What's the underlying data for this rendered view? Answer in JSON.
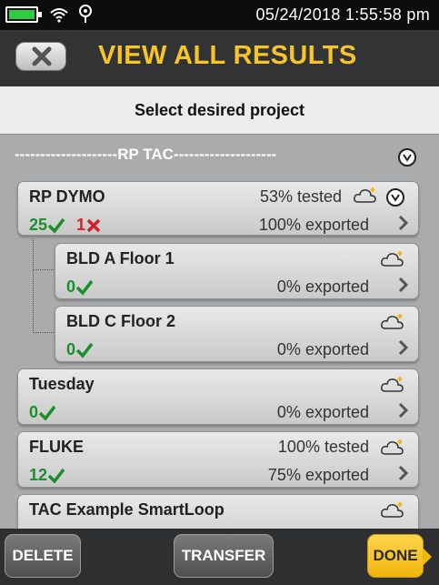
{
  "status_bar": {
    "datetime": "05/24/2018  1:55:58 pm",
    "battery_color": "#2ecc40",
    "icons": [
      "battery-icon",
      "wifi-icon",
      "location-pin-icon"
    ]
  },
  "header": {
    "title": "VIEW ALL RESULTS",
    "back_icon": "close-x-icon",
    "title_color": "#f7c42a"
  },
  "subtitle": "Select desired project",
  "group": {
    "label": "--------------------RP TAC--------------------",
    "icon": "collapse-chevron-icon"
  },
  "projects": [
    {
      "name": "RP DYMO",
      "tested": "53% tested",
      "pass": "25",
      "fail": "1",
      "exported": "100% exported"
    },
    {
      "name": "BLD A Floor 1",
      "pass": "0",
      "exported": "0% exported"
    },
    {
      "name": "BLD C Floor 2",
      "pass": "0",
      "exported": "0% exported"
    },
    {
      "name": "Tuesday",
      "pass": "0",
      "exported": "0% exported"
    },
    {
      "name": "FLUKE",
      "tested": "100% tested",
      "pass": "12",
      "exported": "75% exported"
    },
    {
      "name": "TAC Example SmartLoop"
    }
  ],
  "footer": {
    "delete": "DELETE",
    "transfer": "TRANSFER",
    "done": "DONE"
  },
  "colors": {
    "pass": "#1a8f2b",
    "fail": "#d0212a",
    "done_button": "#f0b60e"
  }
}
